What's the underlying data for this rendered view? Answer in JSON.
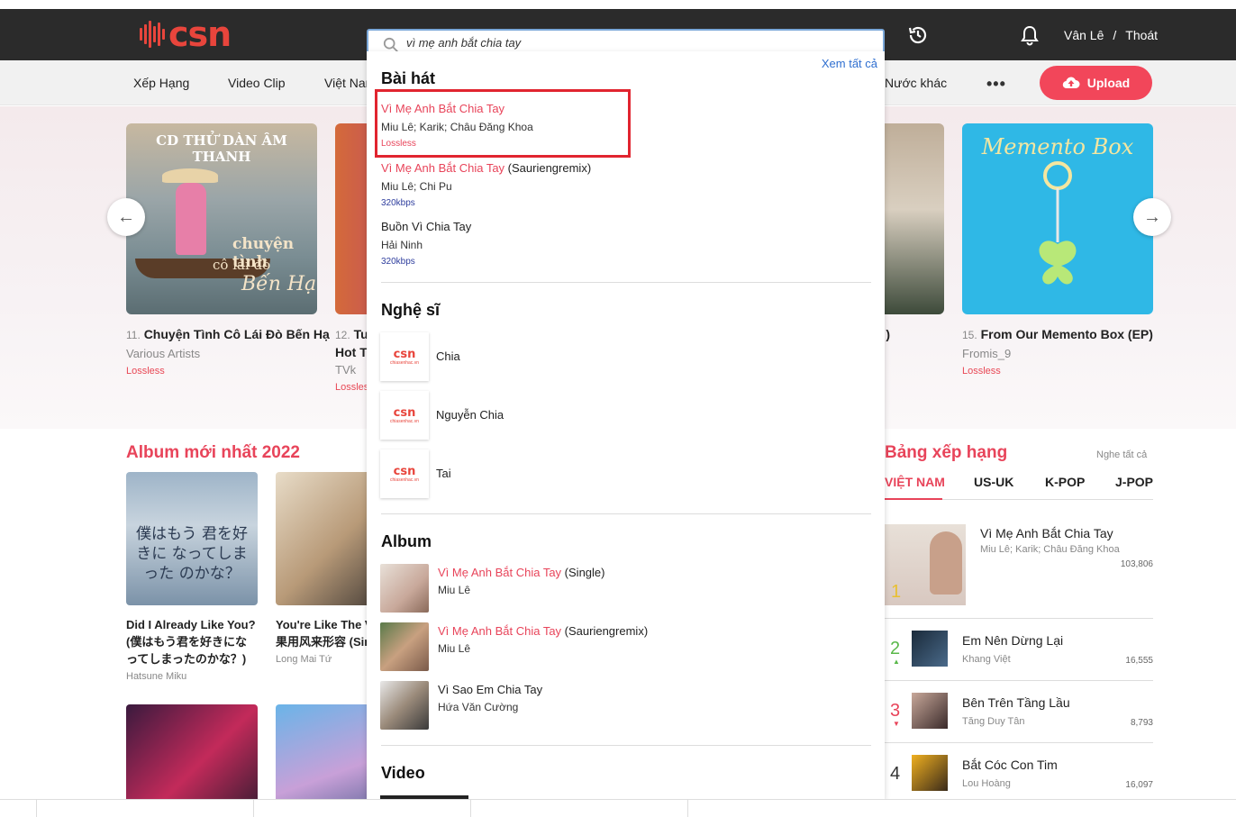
{
  "header": {
    "logo": "csn",
    "search": {
      "value": "vì mẹ anh bắt chia tay"
    },
    "user_name": "Vân Lê",
    "separator": "/",
    "logout": "Thoát"
  },
  "nav": {
    "items": [
      "Xếp Hạng",
      "Video Clip",
      "Việt Nam",
      "Nước khác"
    ],
    "more": "•••",
    "upload": "Upload"
  },
  "hero": {
    "cards": [
      {
        "rank": "11.",
        "title": "Chuyện Tình Cô Lái Đò Bến Hạ",
        "artist": "Various Artists",
        "quality": "Lossless",
        "cover_text": "CD THỬ DÀN ÂM THANH",
        "cover_sub1": "chuyện tình",
        "cover_sub2": "cô lái đò",
        "cover_sub3": "Bến Hạ"
      },
      {
        "rank": "12.",
        "title": "Tu",
        "title2": "Hot Ti",
        "artist": "TVk",
        "quality": "Lossless"
      },
      {
        "rank": "",
        "title": ")"
      },
      {
        "rank": "15.",
        "title": "From Our Memento Box (EP)",
        "artist": "Fromis_9",
        "quality": "Lossless",
        "cover_text": "Memento Box"
      }
    ]
  },
  "albums": {
    "heading": "Album mới nhất 2022",
    "items": [
      {
        "title": "Did I Already Like You? (僕はもう君を好きになってしまったのかな？)",
        "artist": "Hatsune Miku",
        "cover_text": "僕はもう 君を好きに なってしまった のかな？"
      },
      {
        "title": "You're Like The V (如果用风来形容 (Single)",
        "artist": "Long Mai Tứ"
      }
    ]
  },
  "ranking": {
    "heading": "Bảng xếp hạng",
    "view_all": "Nghe tất cả",
    "tabs": [
      "VIỆT NAM",
      "US-UK",
      "K-POP",
      "J-POP"
    ],
    "rows": [
      {
        "num": "1",
        "title": "Vì Mẹ Anh Bắt Chia Tay",
        "artist": "Miu Lê; Karik; Châu Đăng Khoa",
        "count": "103,806"
      },
      {
        "num": "2",
        "title": "Em Nên Dừng Lại",
        "artist": "Khang Việt",
        "count": "16,555"
      },
      {
        "num": "3",
        "title": "Bên Trên Tầng Lầu",
        "artist": "Tăng Duy Tân",
        "count": "8,793"
      },
      {
        "num": "4",
        "title": "Bắt Cóc Con Tim",
        "artist": "Lou Hoàng",
        "count": "16,097"
      }
    ]
  },
  "dropdown": {
    "view_all": "Xem tất cả",
    "songs_heading": "Bài hát",
    "songs": [
      {
        "title_hl": "Vì Mẹ Anh Bắt Chia Tay",
        "title_rest": "",
        "artists": "Miu Lê; Karik; Châu Đăng Khoa",
        "quality": "Lossless"
      },
      {
        "title_hl": "Vì Mẹ Anh Bắt Chia Tay",
        "title_rest": " (Sauriengremix)",
        "artists": "Miu Lê; Chi Pu",
        "quality": "320kbps"
      },
      {
        "title_hl": "",
        "title_rest": "Buồn Vì Chia Tay",
        "artists": "Hải Ninh",
        "quality": "320kbps"
      }
    ],
    "artists_heading": "Nghệ sĩ",
    "artists": [
      "Chia",
      "Nguyễn Chia",
      "Tai"
    ],
    "artist_thumb_logo": "csn",
    "artist_thumb_sub": "chiasenhac.vn",
    "albums_heading": "Album",
    "albums": [
      {
        "title_hl": "Vì Mẹ Anh Bắt Chia Tay",
        "title_rest": " (Single)",
        "artist": "Miu Lê"
      },
      {
        "title_hl": "Vì Mẹ Anh Bắt Chia Tay",
        "title_rest": " (Sauriengremix)",
        "artist": "Miu Lê"
      },
      {
        "title_hl": "",
        "title_rest": "Vì Sao Em Chia Tay",
        "artist": "Hứa Văn Cường"
      }
    ],
    "video_heading": "Video"
  }
}
